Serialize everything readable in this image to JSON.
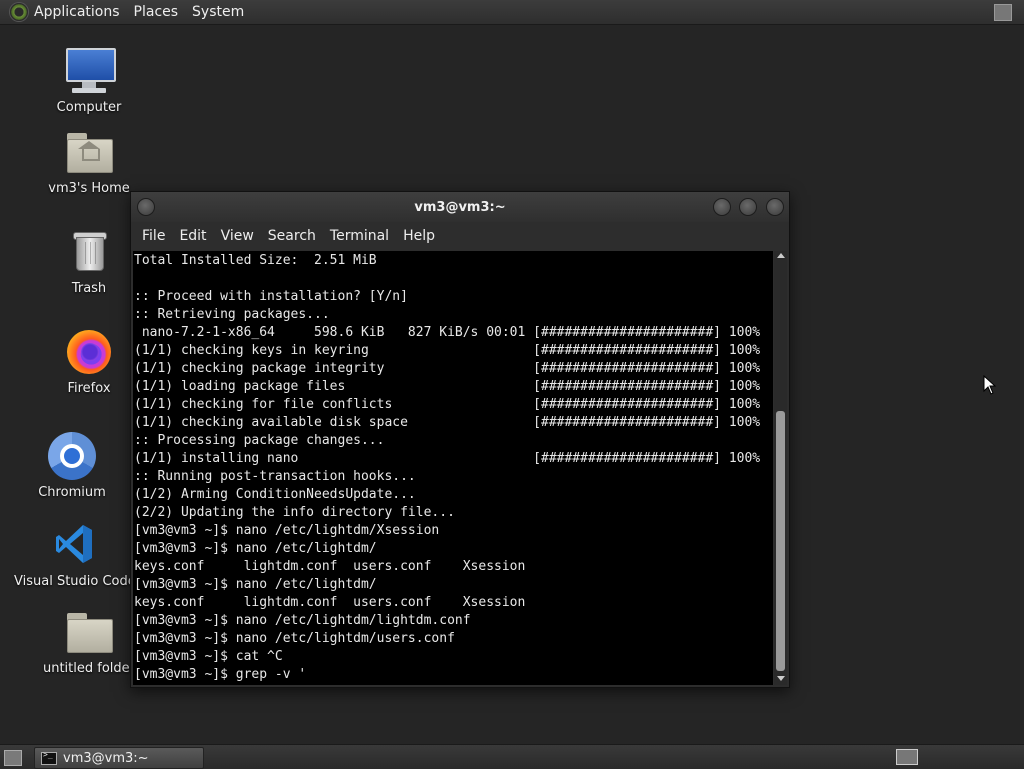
{
  "top_panel": {
    "menus": [
      "Applications",
      "Places",
      "System"
    ]
  },
  "desktop": {
    "icons": [
      {
        "label": "Computer",
        "icon": "computer-icon"
      },
      {
        "label": "vm3's Home",
        "icon": "home-folder-icon"
      },
      {
        "label": "Trash",
        "icon": "trash-icon"
      },
      {
        "label": "Firefox",
        "icon": "firefox-icon"
      },
      {
        "label": "Chromium",
        "icon": "chromium-icon"
      },
      {
        "label": "Visual Studio Code",
        "icon": "vscode-icon"
      },
      {
        "label": "untitled folder",
        "icon": "folder-icon"
      }
    ]
  },
  "terminal": {
    "title": "vm3@vm3:~",
    "menu": [
      "File",
      "Edit",
      "View",
      "Search",
      "Terminal",
      "Help"
    ],
    "lines": [
      "Total Installed Size:  2.51 MiB",
      "",
      ":: Proceed with installation? [Y/n]",
      ":: Retrieving packages...",
      " nano-7.2-1-x86_64     598.6 KiB   827 KiB/s 00:01 [######################] 100%",
      "(1/1) checking keys in keyring                     [######################] 100%",
      "(1/1) checking package integrity                   [######################] 100%",
      "(1/1) loading package files                        [######################] 100%",
      "(1/1) checking for file conflicts                  [######################] 100%",
      "(1/1) checking available disk space                [######################] 100%",
      ":: Processing package changes...",
      "(1/1) installing nano                              [######################] 100%",
      ":: Running post-transaction hooks...",
      "(1/2) Arming ConditionNeedsUpdate...",
      "(2/2) Updating the info directory file...",
      "[vm3@vm3 ~]$ nano /etc/lightdm/Xsession",
      "[vm3@vm3 ~]$ nano /etc/lightdm/",
      "keys.conf     lightdm.conf  users.conf    Xsession",
      "[vm3@vm3 ~]$ nano /etc/lightdm/",
      "keys.conf     lightdm.conf  users.conf    Xsession",
      "[vm3@vm3 ~]$ nano /etc/lightdm/lightdm.conf",
      "[vm3@vm3 ~]$ nano /etc/lightdm/users.conf",
      "[vm3@vm3 ~]$ cat ^C",
      "[vm3@vm3 ~]$ grep -v '"
    ]
  },
  "taskbar": {
    "task_label": "vm3@vm3:~"
  }
}
